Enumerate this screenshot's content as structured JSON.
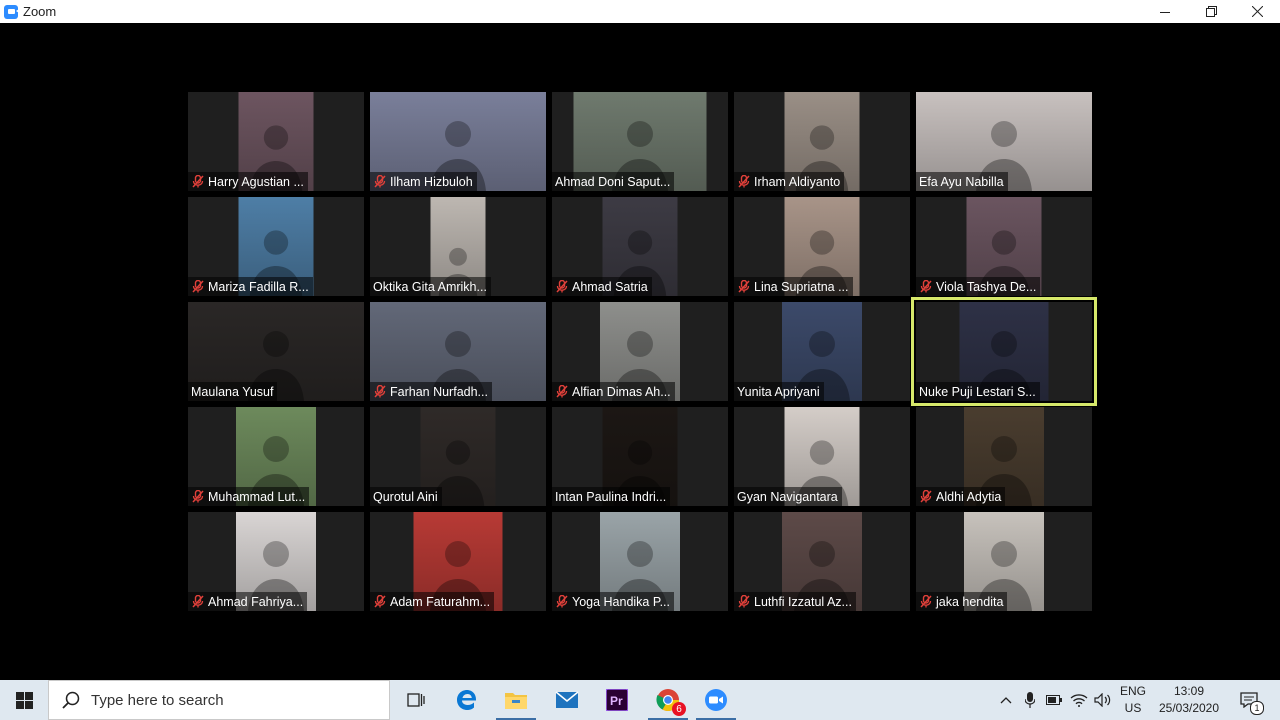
{
  "window": {
    "title": "Zoom",
    "controls": [
      "minimize-icon",
      "restore-icon",
      "close-icon"
    ]
  },
  "participants": [
    {
      "name": "Harry Agustian ...",
      "muted": true,
      "bg": "#6d5560",
      "video_w": 75
    },
    {
      "name": "Ilham Hizbuloh",
      "muted": true,
      "bg": "#7a7f9a",
      "video_w": 176
    },
    {
      "name": "Ahmad Doni Saput...",
      "muted": false,
      "bg": "#6f7a6e",
      "video_w": 133
    },
    {
      "name": "Irham Aldiyanto",
      "muted": true,
      "bg": "#9a8f86",
      "video_w": 75
    },
    {
      "name": "Efa Ayu Nabilla",
      "muted": false,
      "bg": "#c8c1bf",
      "video_w": 176
    },
    {
      "name": "Mariza Fadilla R...",
      "muted": true,
      "bg": "#4e7ea6",
      "video_w": 75
    },
    {
      "name": "Oktika Gita Amrikh...",
      "muted": false,
      "bg": "#bdb7b1",
      "video_w": 55
    },
    {
      "name": "Ahmad Satria",
      "muted": true,
      "bg": "#3d3b44",
      "video_w": 75
    },
    {
      "name": "Lina Supriatna ...",
      "muted": true,
      "bg": "#a89488",
      "video_w": 75
    },
    {
      "name": "Viola Tashya De...",
      "muted": true,
      "bg": "#6b5560",
      "video_w": 75
    },
    {
      "name": "Maulana Yusuf",
      "muted": false,
      "bg": "#2a2726",
      "video_w": 176
    },
    {
      "name": "Farhan Nurfadh...",
      "muted": true,
      "bg": "#626878",
      "video_w": 176
    },
    {
      "name": "Alfian Dimas Ah...",
      "muted": true,
      "bg": "#8e8f8c",
      "video_w": 80
    },
    {
      "name": "Yunita Apriyani",
      "muted": false,
      "bg": "#3c4a6a",
      "video_w": 80
    },
    {
      "name": "Nuke Puji Lestari S...",
      "muted": false,
      "bg": "#2e3146",
      "video_w": 89,
      "active": true
    },
    {
      "name": "Muhammad Lut...",
      "muted": true,
      "bg": "#6d8a5c",
      "video_w": 80
    },
    {
      "name": "Qurotul Aini",
      "muted": false,
      "bg": "#2f2a28",
      "video_w": 75
    },
    {
      "name": "Intan Paulina Indri...",
      "muted": false,
      "bg": "#1c1714",
      "video_w": 75
    },
    {
      "name": "Gyan Navigantara",
      "muted": false,
      "bg": "#d4cdc8",
      "video_w": 75
    },
    {
      "name": "Aldhi Adytia",
      "muted": true,
      "bg": "#4a3d2f",
      "video_w": 80
    },
    {
      "name": "Ahmad Fahriya...",
      "muted": true,
      "bg": "#d9d5d4",
      "video_w": 80
    },
    {
      "name": "Adam Faturahm...",
      "muted": true,
      "bg": "#b83a35",
      "video_w": 89
    },
    {
      "name": "Yoga Handika P...",
      "muted": true,
      "bg": "#9aa4a8",
      "video_w": 80
    },
    {
      "name": "Luthfi Izzatul Az...",
      "muted": true,
      "bg": "#5d4a48",
      "video_w": 80
    },
    {
      "name": "jaka hendita",
      "muted": true,
      "bg": "#c7c2bc",
      "video_w": 80
    }
  ],
  "taskbar": {
    "search_placeholder": "Type here to search",
    "pinned": [
      "task-view-icon",
      "edge-icon",
      "file-explorer-icon",
      "mail-icon",
      "premiere-icon",
      "chrome-icon",
      "zoom-icon"
    ],
    "chrome_badge": "6",
    "language": "ENG",
    "region": "US",
    "time": "13:09",
    "date": "25/03/2020",
    "notification_count": "1"
  },
  "colors": {
    "active_speaker": "#d6e86a",
    "mute_red": "#e0403a",
    "zoom_blue": "#2d8cff"
  }
}
